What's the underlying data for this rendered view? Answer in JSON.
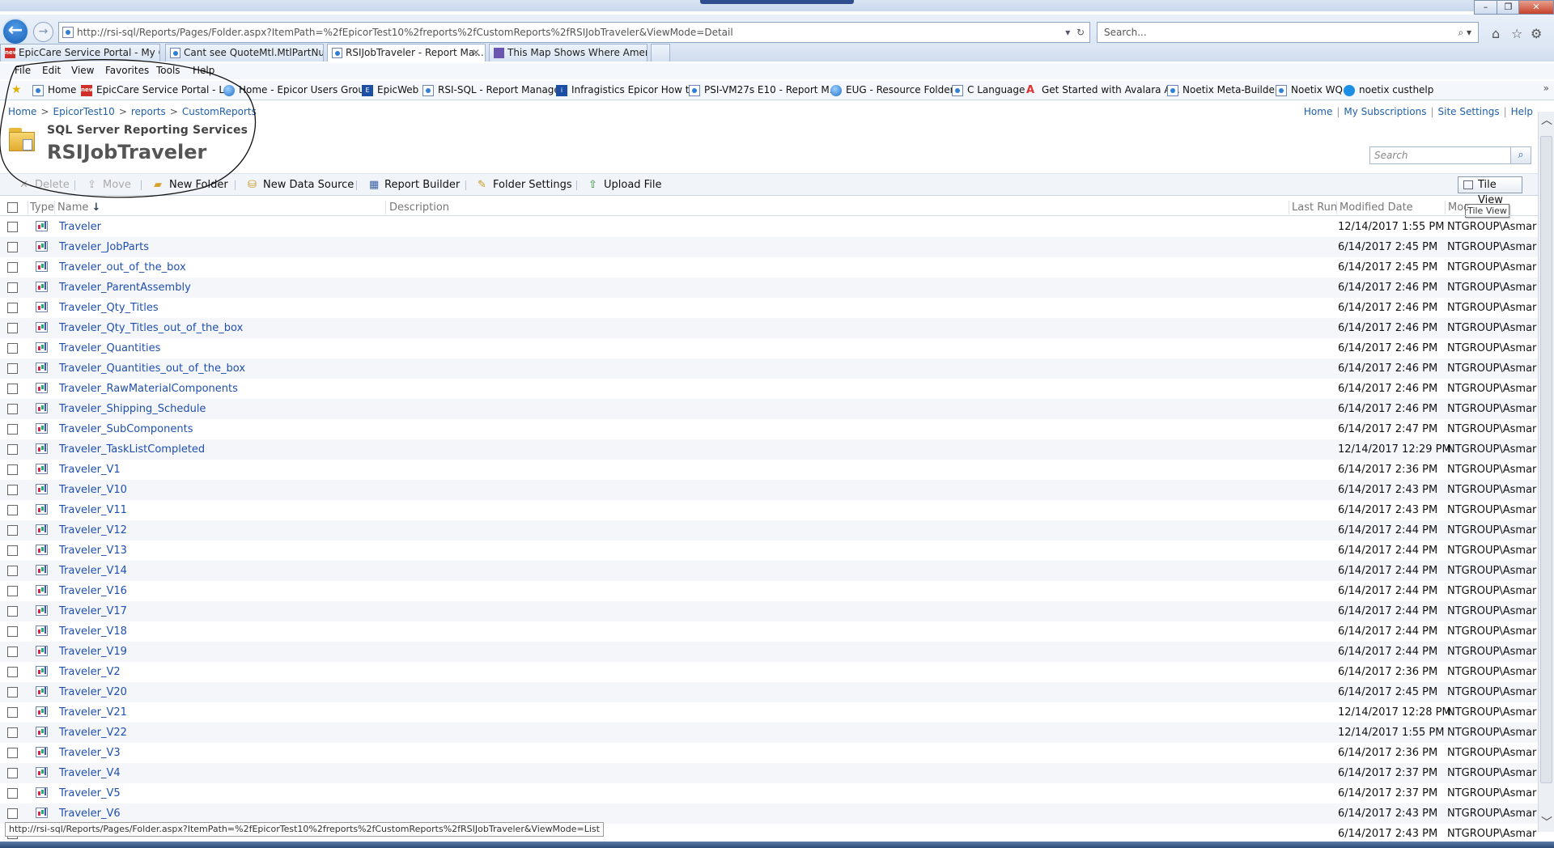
{
  "browser": {
    "window_buttons": {
      "minimize": "–",
      "restore": "❐",
      "close": "✕"
    },
    "address": "http://rsi-sql/Reports/Pages/Folder.aspx?ItemPath=%2fEpicorTest10%2freports%2fCustomReports%2fRSIJobTraveler&ViewMode=Detail",
    "search_placeholder": "Search...",
    "tabs": [
      {
        "label": "EpicCare Service Portal - My O...",
        "icon": "epicor-red-icon",
        "active": false
      },
      {
        "label": "Cant see QuoteMtl.MtlPartNu...",
        "icon": "ie-page-icon",
        "active": false
      },
      {
        "label": "RSIJobTraveler - Report Ma...",
        "icon": "ie-page-icon",
        "active": true
      },
      {
        "label": "This Map Shows Where Ameri...",
        "icon": "map-icon",
        "active": false
      }
    ],
    "menu": [
      "File",
      "Edit",
      "View",
      "Favorites",
      "Tools",
      "Help"
    ],
    "favorites": [
      {
        "label": "Home",
        "icon": "ie-page-icon"
      },
      {
        "label": "EpicCare Service Portal - L...",
        "icon": "epicor-red-icon"
      },
      {
        "label": "Home - Epicor Users Group",
        "icon": "globe-icon"
      },
      {
        "label": "EpicWeb",
        "icon": "epicweb-icon"
      },
      {
        "label": "RSI-SQL - Report Manager",
        "icon": "ie-page-icon"
      },
      {
        "label": "Infragistics Epicor How to",
        "icon": "infragistics-icon"
      },
      {
        "label": "PSI-VM27s E10 - Report M...",
        "icon": "ie-page-icon"
      },
      {
        "label": "EUG - Resource Folders",
        "icon": "globe-icon"
      },
      {
        "label": "C Language",
        "icon": "ie-page-icon"
      },
      {
        "label": "Get Started with Avalara A...",
        "icon": "avalara-icon"
      },
      {
        "label": "Noetix Meta-Builder",
        "icon": "ie-page-icon"
      },
      {
        "label": "Noetix WQ",
        "icon": "ie-page-icon"
      },
      {
        "label": "noetix custhelp",
        "icon": "cloud-icon"
      }
    ],
    "status_url": "http://rsi-sql/Reports/Pages/Folder.aspx?ItemPath=%2fEpicorTest10%2freports%2fCustomReports%2fRSIJobTraveler&ViewMode=List"
  },
  "ssrs": {
    "breadcrumb": [
      "Home",
      "EpicorTest10",
      "reports",
      "CustomReports"
    ],
    "top_links": [
      "Home",
      "My Subscriptions",
      "Site Settings",
      "Help"
    ],
    "product_label": "SQL Server Reporting Services",
    "folder_title": "RSIJobTraveler",
    "search_placeholder": "Search",
    "toolbar": {
      "delete": "Delete",
      "move": "Move",
      "new_folder": "New Folder",
      "new_data_source": "New Data Source",
      "report_builder": "Report Builder",
      "folder_settings": "Folder Settings",
      "upload_file": "Upload File",
      "tile_view": "Tile View"
    },
    "tooltip": "Tile View",
    "columns": {
      "type": "Type",
      "name": "Name",
      "sort_indicator": "↓",
      "description": "Description",
      "last_run": "Last Run",
      "modified_date": "Modified Date",
      "modified_by": "Mod"
    },
    "rows": [
      {
        "name": "Traveler",
        "modified": "12/14/2017 1:55 PM",
        "modified_by": "NTGROUP\\Asmar"
      },
      {
        "name": "Traveler_JobParts",
        "modified": "6/14/2017 2:45 PM",
        "modified_by": "NTGROUP\\Asmar"
      },
      {
        "name": "Traveler_out_of_the_box",
        "modified": "6/14/2017 2:45 PM",
        "modified_by": "NTGROUP\\Asmar"
      },
      {
        "name": "Traveler_ParentAssembly",
        "modified": "6/14/2017 2:46 PM",
        "modified_by": "NTGROUP\\Asmar"
      },
      {
        "name": "Traveler_Qty_Titles",
        "modified": "6/14/2017 2:46 PM",
        "modified_by": "NTGROUP\\Asmar"
      },
      {
        "name": "Traveler_Qty_Titles_out_of_the_box",
        "modified": "6/14/2017 2:46 PM",
        "modified_by": "NTGROUP\\Asmar"
      },
      {
        "name": "Traveler_Quantities",
        "modified": "6/14/2017 2:46 PM",
        "modified_by": "NTGROUP\\Asmar"
      },
      {
        "name": "Traveler_Quantities_out_of_the_box",
        "modified": "6/14/2017 2:46 PM",
        "modified_by": "NTGROUP\\Asmar"
      },
      {
        "name": "Traveler_RawMaterialComponents",
        "modified": "6/14/2017 2:46 PM",
        "modified_by": "NTGROUP\\Asmar"
      },
      {
        "name": "Traveler_Shipping_Schedule",
        "modified": "6/14/2017 2:46 PM",
        "modified_by": "NTGROUP\\Asmar"
      },
      {
        "name": "Traveler_SubComponents",
        "modified": "6/14/2017 2:47 PM",
        "modified_by": "NTGROUP\\Asmar"
      },
      {
        "name": "Traveler_TaskListCompleted",
        "modified": "12/14/2017 12:29 PM",
        "modified_by": "NTGROUP\\Asmar"
      },
      {
        "name": "Traveler_V1",
        "modified": "6/14/2017 2:36 PM",
        "modified_by": "NTGROUP\\Asmar"
      },
      {
        "name": "Traveler_V10",
        "modified": "6/14/2017 2:43 PM",
        "modified_by": "NTGROUP\\Asmar"
      },
      {
        "name": "Traveler_V11",
        "modified": "6/14/2017 2:43 PM",
        "modified_by": "NTGROUP\\Asmar"
      },
      {
        "name": "Traveler_V12",
        "modified": "6/14/2017 2:44 PM",
        "modified_by": "NTGROUP\\Asmar"
      },
      {
        "name": "Traveler_V13",
        "modified": "6/14/2017 2:44 PM",
        "modified_by": "NTGROUP\\Asmar"
      },
      {
        "name": "Traveler_V14",
        "modified": "6/14/2017 2:44 PM",
        "modified_by": "NTGROUP\\Asmar"
      },
      {
        "name": "Traveler_V16",
        "modified": "6/14/2017 2:44 PM",
        "modified_by": "NTGROUP\\Asmar"
      },
      {
        "name": "Traveler_V17",
        "modified": "6/14/2017 2:44 PM",
        "modified_by": "NTGROUP\\Asmar"
      },
      {
        "name": "Traveler_V18",
        "modified": "6/14/2017 2:44 PM",
        "modified_by": "NTGROUP\\Asmar"
      },
      {
        "name": "Traveler_V19",
        "modified": "6/14/2017 2:44 PM",
        "modified_by": "NTGROUP\\Asmar"
      },
      {
        "name": "Traveler_V2",
        "modified": "6/14/2017 2:36 PM",
        "modified_by": "NTGROUP\\Asmar"
      },
      {
        "name": "Traveler_V20",
        "modified": "6/14/2017 2:45 PM",
        "modified_by": "NTGROUP\\Asmar"
      },
      {
        "name": "Traveler_V21",
        "modified": "12/14/2017 12:28 PM",
        "modified_by": "NTGROUP\\Asmar"
      },
      {
        "name": "Traveler_V22",
        "modified": "12/14/2017 1:55 PM",
        "modified_by": "NTGROUP\\Asmar"
      },
      {
        "name": "Traveler_V3",
        "modified": "6/14/2017 2:36 PM",
        "modified_by": "NTGROUP\\Asmar"
      },
      {
        "name": "Traveler_V4",
        "modified": "6/14/2017 2:37 PM",
        "modified_by": "NTGROUP\\Asmar"
      },
      {
        "name": "Traveler_V5",
        "modified": "6/14/2017 2:37 PM",
        "modified_by": "NTGROUP\\Asmar"
      },
      {
        "name": "Traveler_V6",
        "modified": "6/14/2017 2:43 PM",
        "modified_by": "NTGROUP\\Asmar"
      },
      {
        "name": "",
        "modified": "6/14/2017 2:43 PM",
        "modified_by": "NTGROUP\\Asmar"
      }
    ]
  },
  "colors": {
    "link": "#1f4fae",
    "chrome": "#dbe6f4",
    "annotation": "#111111"
  }
}
